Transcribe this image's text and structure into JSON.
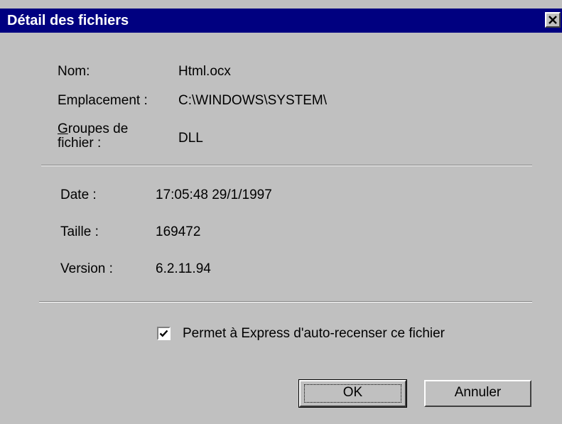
{
  "window": {
    "title": "Détail des fichiers",
    "close_glyph": "✕"
  },
  "file_info": {
    "name_label": "Nom:",
    "name_value": "Html.ocx",
    "location_label": "Emplacement :",
    "location_value": "C:\\WINDOWS\\SYSTEM\\",
    "group_label_accel": "G",
    "group_label_rest": "roupes de fichier :",
    "group_value": "DLL"
  },
  "details": {
    "date_label": "Date :",
    "date_value": "17:05:48  29/1/1997",
    "size_label": "Taille :",
    "size_value": "169472",
    "version_label": "Version :",
    "version_value": "6.2.11.94"
  },
  "options": {
    "auto_register_label": "Permet à Express d'auto-recenser ce fichier",
    "auto_register_checked": true
  },
  "buttons": {
    "ok_label": "OK",
    "cancel_label": "Annuler"
  }
}
